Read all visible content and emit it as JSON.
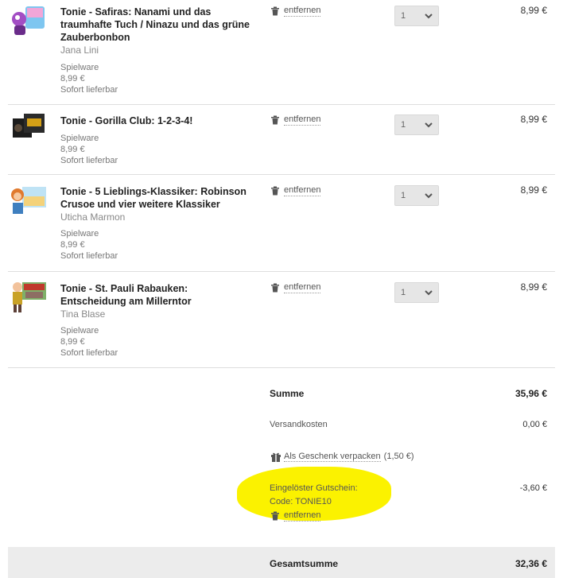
{
  "cart": {
    "items": [
      {
        "title": "Tonie - Safiras: Nanami und das traumhafte Tuch / Ninazu und das grüne Zauberbonbon",
        "author": "Jana Lini",
        "category": "Spielware",
        "unit_price": "8,99 €",
        "availability": "Sofort lieferbar",
        "remove_label": "entfernen",
        "quantity": "1",
        "price": "8,99 €"
      },
      {
        "title": "Tonie - Gorilla Club: 1-2-3-4!",
        "author": "",
        "category": "Spielware",
        "unit_price": "8,99 €",
        "availability": "Sofort lieferbar",
        "remove_label": "entfernen",
        "quantity": "1",
        "price": "8,99 €"
      },
      {
        "title": "Tonie - 5 Lieblings-Klassiker: Robinson Crusoe und vier weitere Klassiker",
        "author": "Uticha Marmon",
        "category": "Spielware",
        "unit_price": "8,99 €",
        "availability": "Sofort lieferbar",
        "remove_label": "entfernen",
        "quantity": "1",
        "price": "8,99 €"
      },
      {
        "title": "Tonie - St. Pauli Rabauken: Entscheidung am Millerntor",
        "author": "Tina Blase",
        "category": "Spielware",
        "unit_price": "8,99 €",
        "availability": "Sofort lieferbar",
        "remove_label": "entfernen",
        "quantity": "1",
        "price": "8,99 €"
      }
    ]
  },
  "summary": {
    "subtotal_label": "Summe",
    "subtotal_value": "35,96 €",
    "shipping_label": "Versandkosten",
    "shipping_value": "0,00 €",
    "gift_label": "Als Geschenk verpacken",
    "gift_price": "(1,50 €)",
    "voucher_label": "Eingelöster Gutschein:",
    "voucher_code": "Code: TONIE10",
    "voucher_value": "-3,60 €",
    "voucher_remove": "entfernen",
    "highlight_color": "#fbf200",
    "total_label": "Gesamtsumme",
    "total_value": "32,36 €"
  }
}
